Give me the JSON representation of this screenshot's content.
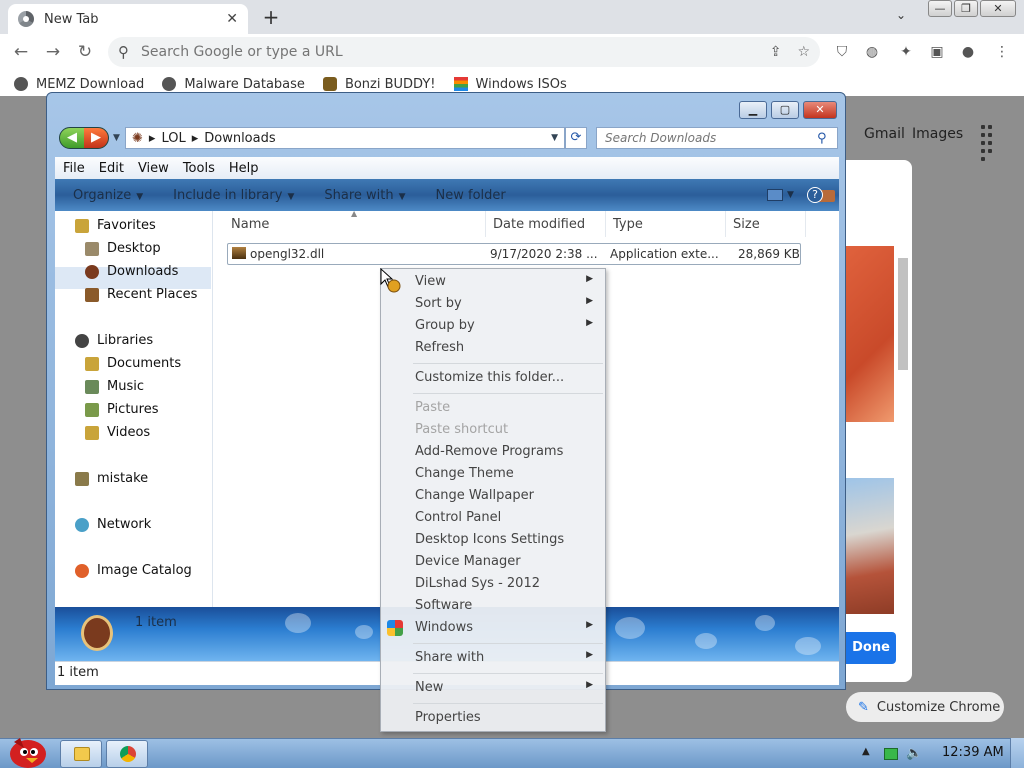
{
  "browser": {
    "tab_title": "New Tab",
    "tab_close": "✕",
    "new_tab": "+",
    "omnibox_placeholder": "Search Google or type a URL",
    "bookmarks": [
      {
        "label": "MEMZ Download",
        "icon": "globe-icon"
      },
      {
        "label": "Malware Database",
        "icon": "globe-icon"
      },
      {
        "label": "Bonzi BUDDY!",
        "icon": "bonzi-icon"
      },
      {
        "label": "Windows ISOs",
        "icon": "windows-flag-icon"
      }
    ]
  },
  "ntp": {
    "gmail": "Gmail",
    "images": "Images",
    "done": "Done",
    "customize": "Customize Chrome"
  },
  "explorer": {
    "breadcrumb": [
      "LOL",
      "Downloads"
    ],
    "search_placeholder": "Search Downloads",
    "menu": [
      "File",
      "Edit",
      "View",
      "Tools",
      "Help"
    ],
    "commands": [
      "Organize",
      "Include in library",
      "Share with",
      "New folder"
    ],
    "nav": {
      "favorites": "Favorites",
      "desktop": "Desktop",
      "downloads": "Downloads",
      "recent": "Recent Places",
      "libraries": "Libraries",
      "documents": "Documents",
      "music": "Music",
      "pictures": "Pictures",
      "videos": "Videos",
      "mistake": "mistake",
      "network": "Network",
      "image_catalog": "Image Catalog"
    },
    "columns": [
      "Name",
      "Date modified",
      "Type",
      "Size"
    ],
    "file": {
      "name": "opengl32.dll",
      "date": "9/17/2020 2:38 ...",
      "type": "Application exte...",
      "size": "28,869 KB"
    },
    "details_text": "1 item",
    "status_text": "1 item"
  },
  "context_menu": {
    "items": [
      {
        "label": "View",
        "submenu": true,
        "disabled": false
      },
      {
        "label": "Sort by",
        "submenu": true,
        "disabled": false
      },
      {
        "label": "Group by",
        "submenu": true,
        "disabled": false
      },
      {
        "label": "Refresh",
        "submenu": false,
        "disabled": false
      },
      {
        "label": "Customize this folder...",
        "submenu": false,
        "disabled": false
      },
      {
        "label": "Paste",
        "submenu": false,
        "disabled": true
      },
      {
        "label": "Paste shortcut",
        "submenu": false,
        "disabled": true
      },
      {
        "label": "Add-Remove Programs",
        "submenu": false,
        "disabled": false
      },
      {
        "label": "Change Theme",
        "submenu": false,
        "disabled": false
      },
      {
        "label": "Change Wallpaper",
        "submenu": false,
        "disabled": false
      },
      {
        "label": "Control Panel",
        "submenu": false,
        "disabled": false
      },
      {
        "label": "Desktop Icons Settings",
        "submenu": false,
        "disabled": false
      },
      {
        "label": "Device Manager",
        "submenu": false,
        "disabled": false
      },
      {
        "label": "DiLshad Sys - 2012",
        "submenu": false,
        "disabled": false
      },
      {
        "label": "Software",
        "submenu": false,
        "disabled": false
      },
      {
        "label": "Windows",
        "submenu": true,
        "disabled": false
      },
      {
        "label": "Share with",
        "submenu": true,
        "disabled": false
      },
      {
        "label": "New",
        "submenu": true,
        "disabled": false
      },
      {
        "label": "Properties",
        "submenu": false,
        "disabled": false
      }
    ]
  },
  "taskbar": {
    "clock": "12:39 AM"
  },
  "colors": {
    "chrome_bg": "#dee1e6",
    "accent_blue": "#1a73e8",
    "explorer_frame": "#7ea7d3"
  }
}
